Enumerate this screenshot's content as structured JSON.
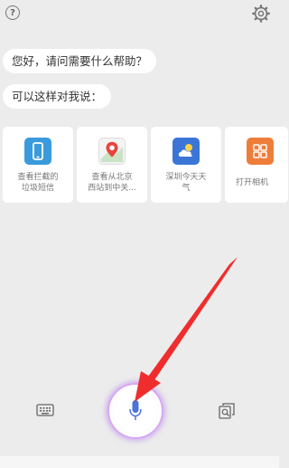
{
  "header": {
    "help_label": "?",
    "help_icon": "help-circle-icon",
    "settings_icon": "gear-icon"
  },
  "conversation": {
    "greeting": "您好，请问需要什么帮助？",
    "prompt": "可以这样对我说："
  },
  "suggestions": [
    {
      "label": "查看拦截的\n垃圾短信",
      "icon": "phone-icon",
      "color": "#3a9bdc"
    },
    {
      "label": "查看从北京\n西站到中关...",
      "icon": "map-pin-icon",
      "color": "#e8443a"
    },
    {
      "label": "深圳今天天\n气",
      "icon": "weather-cloud-sun-icon",
      "color": "#3b76d6"
    },
    {
      "label": "打开相机",
      "icon": "apps-grid-icon",
      "color": "#ef7d3a"
    }
  ],
  "bottom_bar": {
    "keyboard_icon": "keyboard-icon",
    "mic_icon": "microphone-icon",
    "screenshot_icon": "screenshot-search-icon",
    "accent_color": "#b884ee"
  },
  "annotation": {
    "arrow_color": "#f02d2d"
  }
}
